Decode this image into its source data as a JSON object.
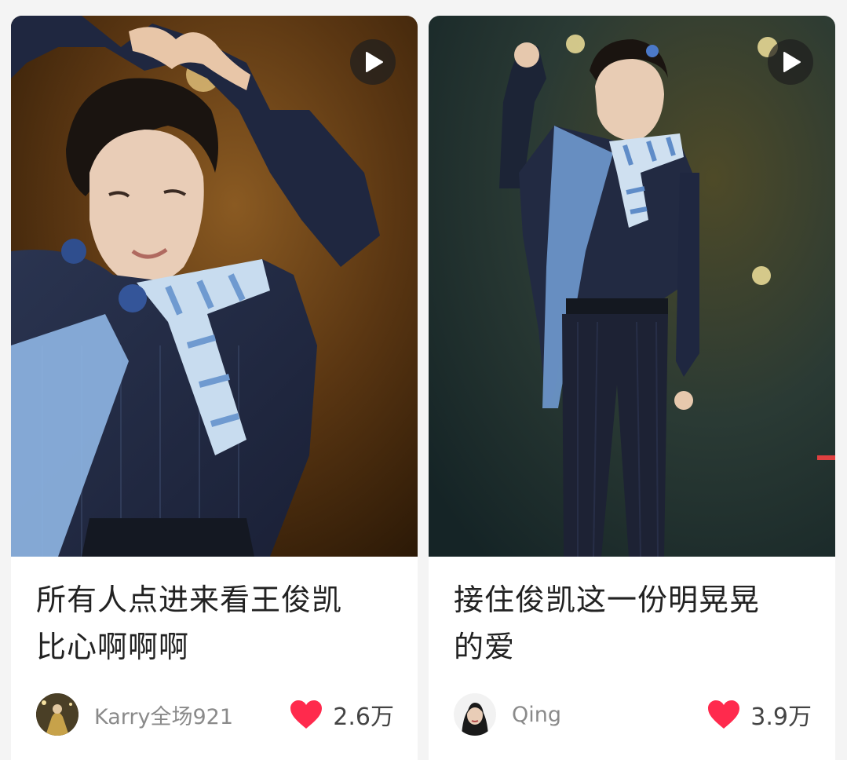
{
  "feed": {
    "cards": [
      {
        "title_line1": "所有人点进来看王俊凯",
        "title_line2": "比心啊啊啊",
        "author": "Karry全场921",
        "likes": "2.6万",
        "cover_icon": "play-icon",
        "like_icon": "heart-icon",
        "like_color": "#ff2a4d"
      },
      {
        "title_line1": "接住俊凯这一份明晃晃",
        "title_line2": "的爱",
        "author": "Qing",
        "likes": "3.9万",
        "cover_icon": "play-icon",
        "like_icon": "heart-icon",
        "like_color": "#ff2a4d"
      }
    ]
  }
}
